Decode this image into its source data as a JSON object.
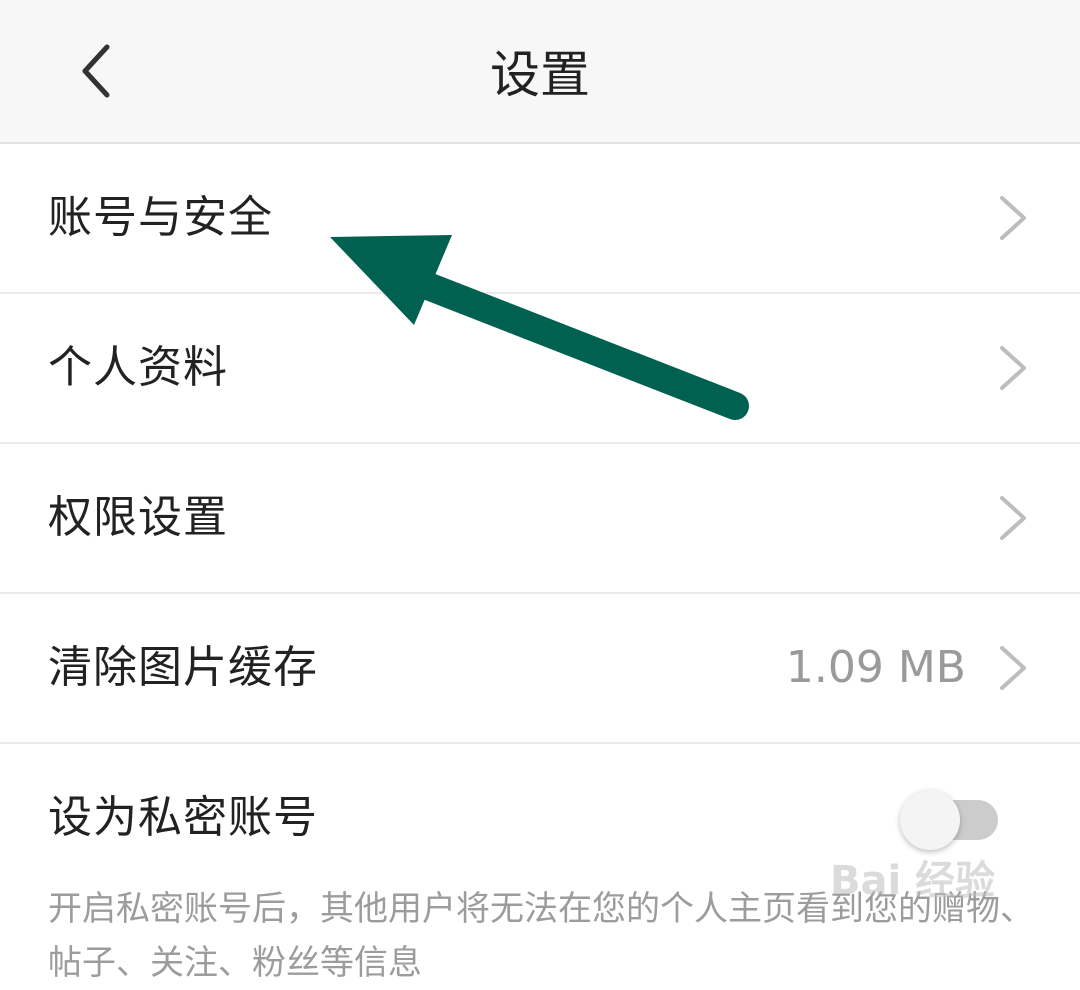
{
  "header": {
    "title": "设置",
    "back_icon": "chevron-left-icon"
  },
  "settings": {
    "items": [
      {
        "label": "账号与安全"
      },
      {
        "label": "个人资料"
      },
      {
        "label": "权限设置"
      },
      {
        "label": "清除图片缓存",
        "value": "1.09 MB"
      }
    ],
    "private_account": {
      "label": "设为私密账号",
      "enabled": false,
      "description": "开启私密账号后，其他用户将无法在您的个人主页看到您的赠物、帖子、关注、粉丝等信息"
    }
  },
  "annotation": {
    "arrow_color": "#006150"
  },
  "watermark": {
    "text": "Bai 经验"
  },
  "colors": {
    "header_bg": "#f7f7f7",
    "text": "#222222",
    "secondary_text": "#9a9a9a",
    "divider": "#ebebeb",
    "toggle_track": "#cccccc"
  }
}
